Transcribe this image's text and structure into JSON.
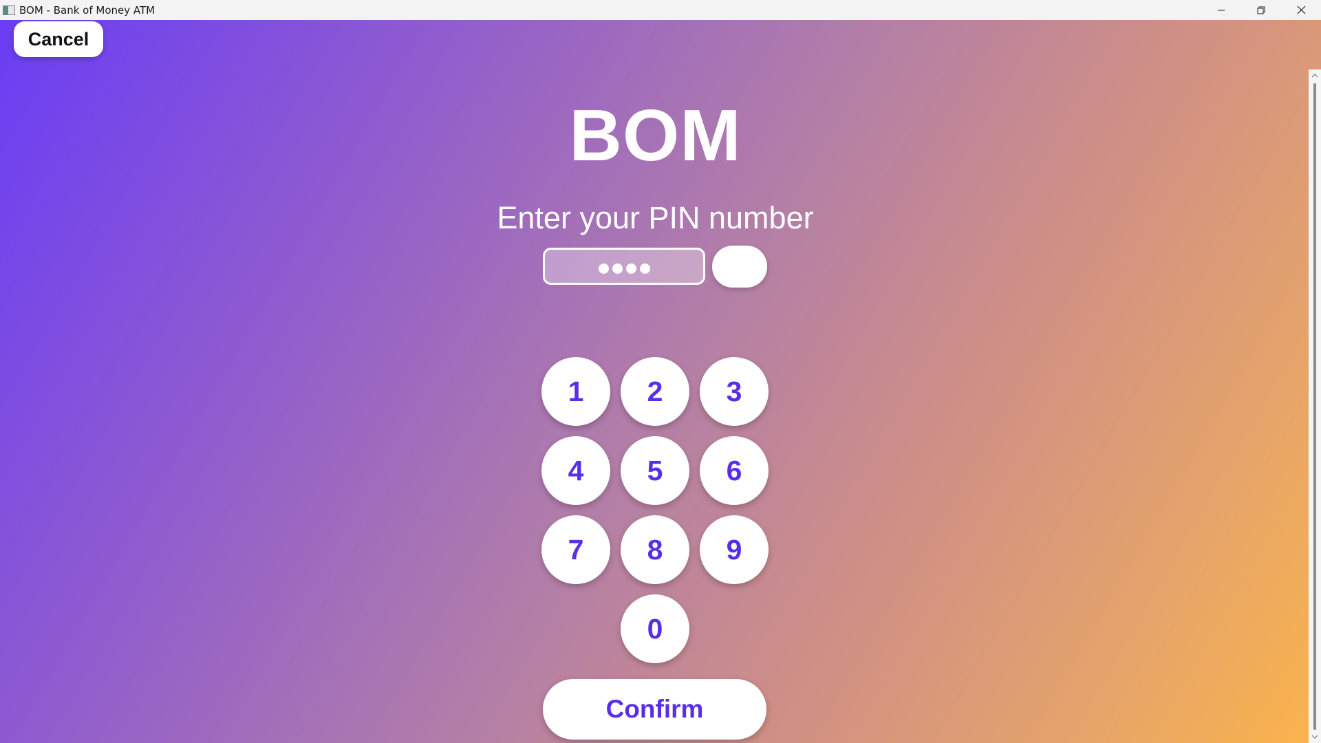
{
  "window": {
    "title": "BOM - Bank of Money ATM"
  },
  "header": {
    "cancel_label": "Cancel",
    "brand": "BOM",
    "prompt": "Enter your PIN number"
  },
  "pin": {
    "masked_length": 4
  },
  "keypad": {
    "keys": [
      "1",
      "2",
      "3",
      "4",
      "5",
      "6",
      "7",
      "8",
      "9",
      "0"
    ]
  },
  "footer": {
    "confirm_label": "Confirm"
  },
  "colors": {
    "accent": "#5a2ee8",
    "gradient_start": "#6a3df5",
    "gradient_end": "#fbb44a"
  }
}
